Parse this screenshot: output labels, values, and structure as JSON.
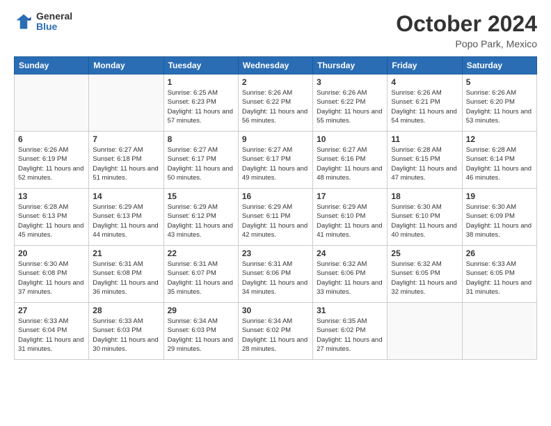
{
  "logo": {
    "general": "General",
    "blue": "Blue"
  },
  "title": "October 2024",
  "location": "Popo Park, Mexico",
  "days_of_week": [
    "Sunday",
    "Monday",
    "Tuesday",
    "Wednesday",
    "Thursday",
    "Friday",
    "Saturday"
  ],
  "weeks": [
    [
      {
        "day": "",
        "info": ""
      },
      {
        "day": "",
        "info": ""
      },
      {
        "day": "1",
        "info": "Sunrise: 6:25 AM\nSunset: 6:23 PM\nDaylight: 11 hours and 57 minutes."
      },
      {
        "day": "2",
        "info": "Sunrise: 6:26 AM\nSunset: 6:22 PM\nDaylight: 11 hours and 56 minutes."
      },
      {
        "day": "3",
        "info": "Sunrise: 6:26 AM\nSunset: 6:22 PM\nDaylight: 11 hours and 55 minutes."
      },
      {
        "day": "4",
        "info": "Sunrise: 6:26 AM\nSunset: 6:21 PM\nDaylight: 11 hours and 54 minutes."
      },
      {
        "day": "5",
        "info": "Sunrise: 6:26 AM\nSunset: 6:20 PM\nDaylight: 11 hours and 53 minutes."
      }
    ],
    [
      {
        "day": "6",
        "info": "Sunrise: 6:26 AM\nSunset: 6:19 PM\nDaylight: 11 hours and 52 minutes."
      },
      {
        "day": "7",
        "info": "Sunrise: 6:27 AM\nSunset: 6:18 PM\nDaylight: 11 hours and 51 minutes."
      },
      {
        "day": "8",
        "info": "Sunrise: 6:27 AM\nSunset: 6:17 PM\nDaylight: 11 hours and 50 minutes."
      },
      {
        "day": "9",
        "info": "Sunrise: 6:27 AM\nSunset: 6:17 PM\nDaylight: 11 hours and 49 minutes."
      },
      {
        "day": "10",
        "info": "Sunrise: 6:27 AM\nSunset: 6:16 PM\nDaylight: 11 hours and 48 minutes."
      },
      {
        "day": "11",
        "info": "Sunrise: 6:28 AM\nSunset: 6:15 PM\nDaylight: 11 hours and 47 minutes."
      },
      {
        "day": "12",
        "info": "Sunrise: 6:28 AM\nSunset: 6:14 PM\nDaylight: 11 hours and 46 minutes."
      }
    ],
    [
      {
        "day": "13",
        "info": "Sunrise: 6:28 AM\nSunset: 6:13 PM\nDaylight: 11 hours and 45 minutes."
      },
      {
        "day": "14",
        "info": "Sunrise: 6:29 AM\nSunset: 6:13 PM\nDaylight: 11 hours and 44 minutes."
      },
      {
        "day": "15",
        "info": "Sunrise: 6:29 AM\nSunset: 6:12 PM\nDaylight: 11 hours and 43 minutes."
      },
      {
        "day": "16",
        "info": "Sunrise: 6:29 AM\nSunset: 6:11 PM\nDaylight: 11 hours and 42 minutes."
      },
      {
        "day": "17",
        "info": "Sunrise: 6:29 AM\nSunset: 6:10 PM\nDaylight: 11 hours and 41 minutes."
      },
      {
        "day": "18",
        "info": "Sunrise: 6:30 AM\nSunset: 6:10 PM\nDaylight: 11 hours and 40 minutes."
      },
      {
        "day": "19",
        "info": "Sunrise: 6:30 AM\nSunset: 6:09 PM\nDaylight: 11 hours and 38 minutes."
      }
    ],
    [
      {
        "day": "20",
        "info": "Sunrise: 6:30 AM\nSunset: 6:08 PM\nDaylight: 11 hours and 37 minutes."
      },
      {
        "day": "21",
        "info": "Sunrise: 6:31 AM\nSunset: 6:08 PM\nDaylight: 11 hours and 36 minutes."
      },
      {
        "day": "22",
        "info": "Sunrise: 6:31 AM\nSunset: 6:07 PM\nDaylight: 11 hours and 35 minutes."
      },
      {
        "day": "23",
        "info": "Sunrise: 6:31 AM\nSunset: 6:06 PM\nDaylight: 11 hours and 34 minutes."
      },
      {
        "day": "24",
        "info": "Sunrise: 6:32 AM\nSunset: 6:06 PM\nDaylight: 11 hours and 33 minutes."
      },
      {
        "day": "25",
        "info": "Sunrise: 6:32 AM\nSunset: 6:05 PM\nDaylight: 11 hours and 32 minutes."
      },
      {
        "day": "26",
        "info": "Sunrise: 6:33 AM\nSunset: 6:05 PM\nDaylight: 11 hours and 31 minutes."
      }
    ],
    [
      {
        "day": "27",
        "info": "Sunrise: 6:33 AM\nSunset: 6:04 PM\nDaylight: 11 hours and 31 minutes."
      },
      {
        "day": "28",
        "info": "Sunrise: 6:33 AM\nSunset: 6:03 PM\nDaylight: 11 hours and 30 minutes."
      },
      {
        "day": "29",
        "info": "Sunrise: 6:34 AM\nSunset: 6:03 PM\nDaylight: 11 hours and 29 minutes."
      },
      {
        "day": "30",
        "info": "Sunrise: 6:34 AM\nSunset: 6:02 PM\nDaylight: 11 hours and 28 minutes."
      },
      {
        "day": "31",
        "info": "Sunrise: 6:35 AM\nSunset: 6:02 PM\nDaylight: 11 hours and 27 minutes."
      },
      {
        "day": "",
        "info": ""
      },
      {
        "day": "",
        "info": ""
      }
    ]
  ]
}
